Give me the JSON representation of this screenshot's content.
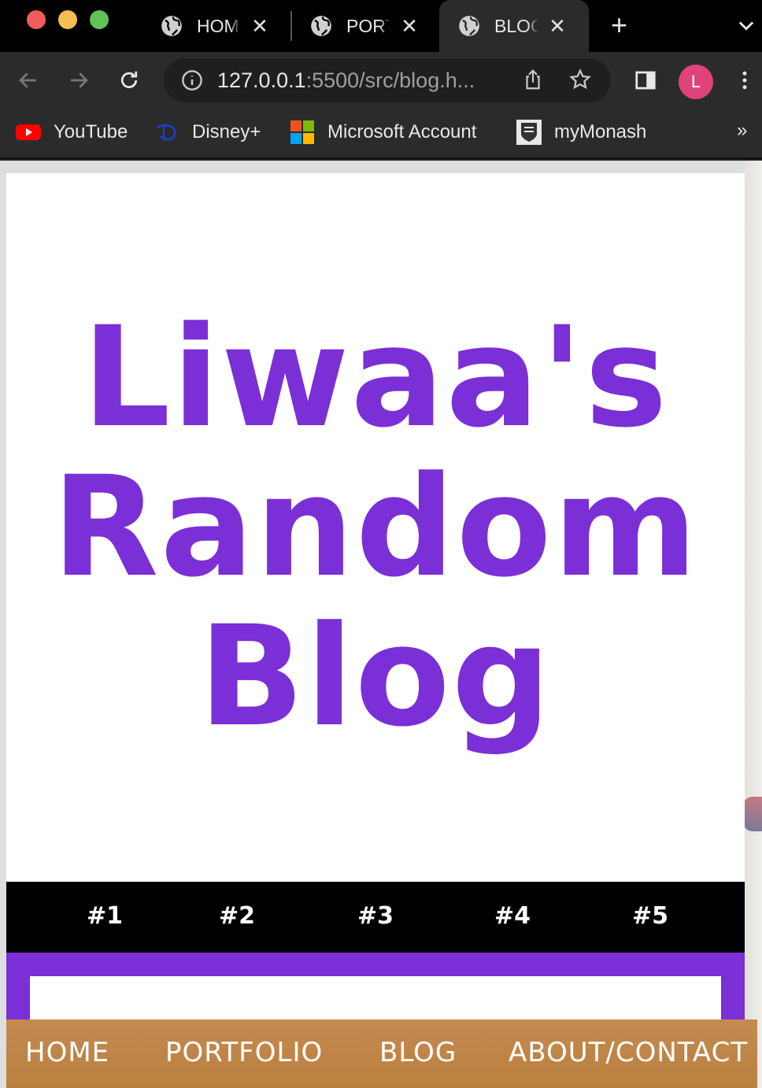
{
  "browser": {
    "tabs": [
      {
        "label": "HOME",
        "active": false
      },
      {
        "label": "PORTFOLIO",
        "active": false
      },
      {
        "label": "BLOG",
        "active": true
      }
    ],
    "url_host": "127.0.0.1",
    "url_rest": ":5500/src/blog.h...",
    "profile_initial": "L",
    "profile_color": "#e0427a",
    "bookmarks": [
      {
        "label": "YouTube",
        "icon": "youtube-icon"
      },
      {
        "label": "Disney+",
        "icon": "disney-icon"
      },
      {
        "label": "Microsoft Account",
        "icon": "microsoft-icon"
      },
      {
        "label": "myMonash",
        "icon": "monash-icon"
      }
    ],
    "bookmarks_overflow": "»"
  },
  "page": {
    "title_line1": "Liwaa's",
    "title_line2": "Random",
    "title_line3": "Blog",
    "accent_color": "#7b2fd6",
    "post_links": [
      "#1",
      "#2",
      "#3",
      "#4",
      "#5"
    ],
    "main_nav": [
      "HOME",
      "PORTFOLIO",
      "BLOG",
      "ABOUT/CONTACT"
    ],
    "nav_color": "#c08648"
  }
}
